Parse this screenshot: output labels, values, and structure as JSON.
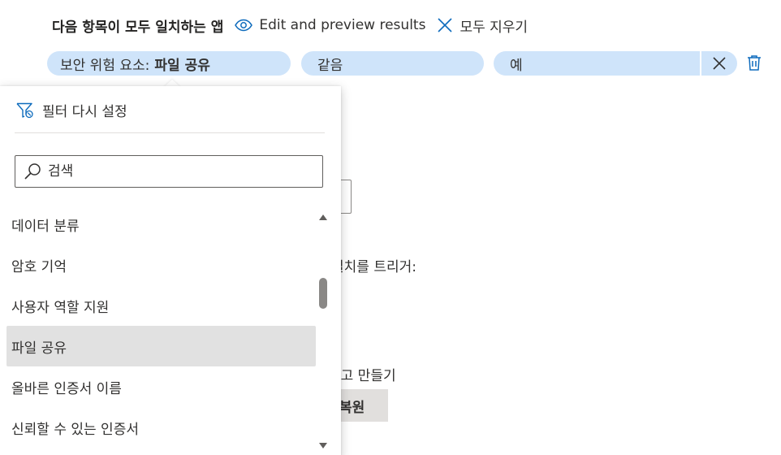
{
  "header": {
    "title": "다음 항목이 모두 일치하는 앱",
    "edit_preview_label": "Edit and preview results",
    "clear_all_label": "모두 지우기"
  },
  "filter": {
    "property_prefix": "보안 위험 요소:",
    "property_value": "파일 공유",
    "operator": "같음",
    "value": "예"
  },
  "dropdown": {
    "reset_label": "필터 다시 설정",
    "search_placeholder": "검색",
    "items": [
      {
        "label": "데이터 분류",
        "selected": false
      },
      {
        "label": "암호 기억",
        "selected": false
      },
      {
        "label": "사용자 역할 지원",
        "selected": false
      },
      {
        "label": "파일 공유",
        "selected": true
      },
      {
        "label": "올바른 인증서 이름",
        "selected": false
      },
      {
        "label": "신뢰할 수 있는 인증서",
        "selected": false
      }
    ]
  },
  "background": {
    "trigger_text": "일치를 트리거:",
    "create_text": "경고 만들기",
    "restore_label": "복원"
  },
  "colors": {
    "pill_bg": "#cfe4fa",
    "accent": "#0f6cbd",
    "selected_bg": "#e1e1e1"
  }
}
